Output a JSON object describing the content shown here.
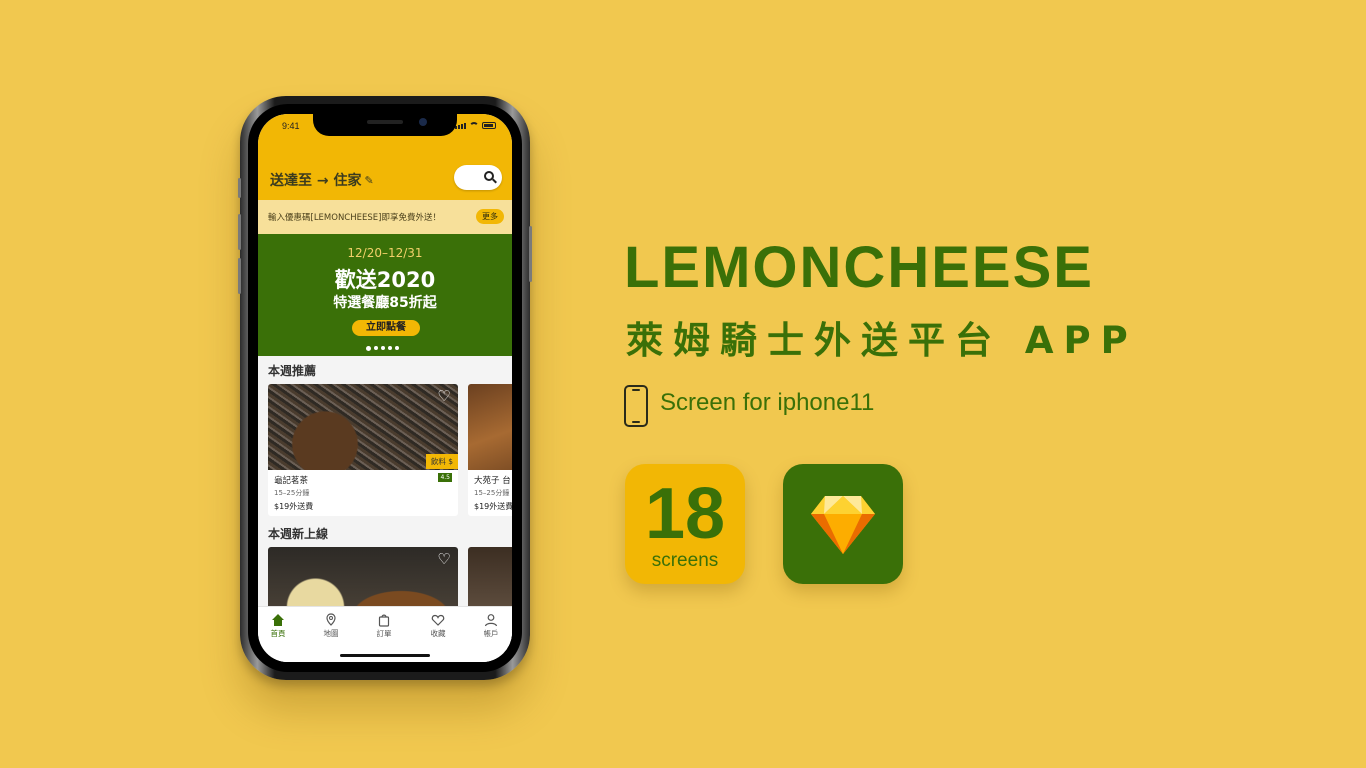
{
  "status": {
    "time": "9:41"
  },
  "header": {
    "deliver_to": "送達至 → 住家"
  },
  "promo": {
    "text": "輸入優惠碼[LEMONCHEESE]即享免費外送！",
    "more": "更多"
  },
  "banner": {
    "date": "12/20–12/31",
    "headline": "歡送2020",
    "sub": "特選餐廳85折起",
    "cta": "立即點餐",
    "dots_total": 5,
    "dots_active": 1
  },
  "sections": {
    "weekly_picks": {
      "title": "本週推薦",
      "cards": [
        {
          "name": "龜記茗茶",
          "time": "15–25分鐘",
          "fee": "$19外送費",
          "tag": "飲料 $",
          "rating": "4.5"
        },
        {
          "name": "大苑子 台",
          "time": "15–25分鐘",
          "fee": "$19外送費"
        }
      ]
    },
    "new_this_week": {
      "title": "本週新上線"
    }
  },
  "tabbar": [
    {
      "label": "首頁",
      "icon": "home-icon",
      "active": true
    },
    {
      "label": "地圖",
      "icon": "map-pin-icon",
      "active": false
    },
    {
      "label": "訂單",
      "icon": "order-bag-icon",
      "active": false
    },
    {
      "label": "收藏",
      "icon": "heart-icon",
      "active": false
    },
    {
      "label": "帳戶",
      "icon": "user-icon",
      "active": false
    }
  ],
  "brand": {
    "name": "LEMONCHEESE",
    "subtitle": "萊姆騎士外送平台 APP",
    "device_line": "Screen for iphone11",
    "screens_count": "18",
    "screens_word": "screens"
  },
  "colors": {
    "background": "#f1c84f",
    "brand_green": "#3a7008",
    "brand_yellow": "#f2b705"
  }
}
